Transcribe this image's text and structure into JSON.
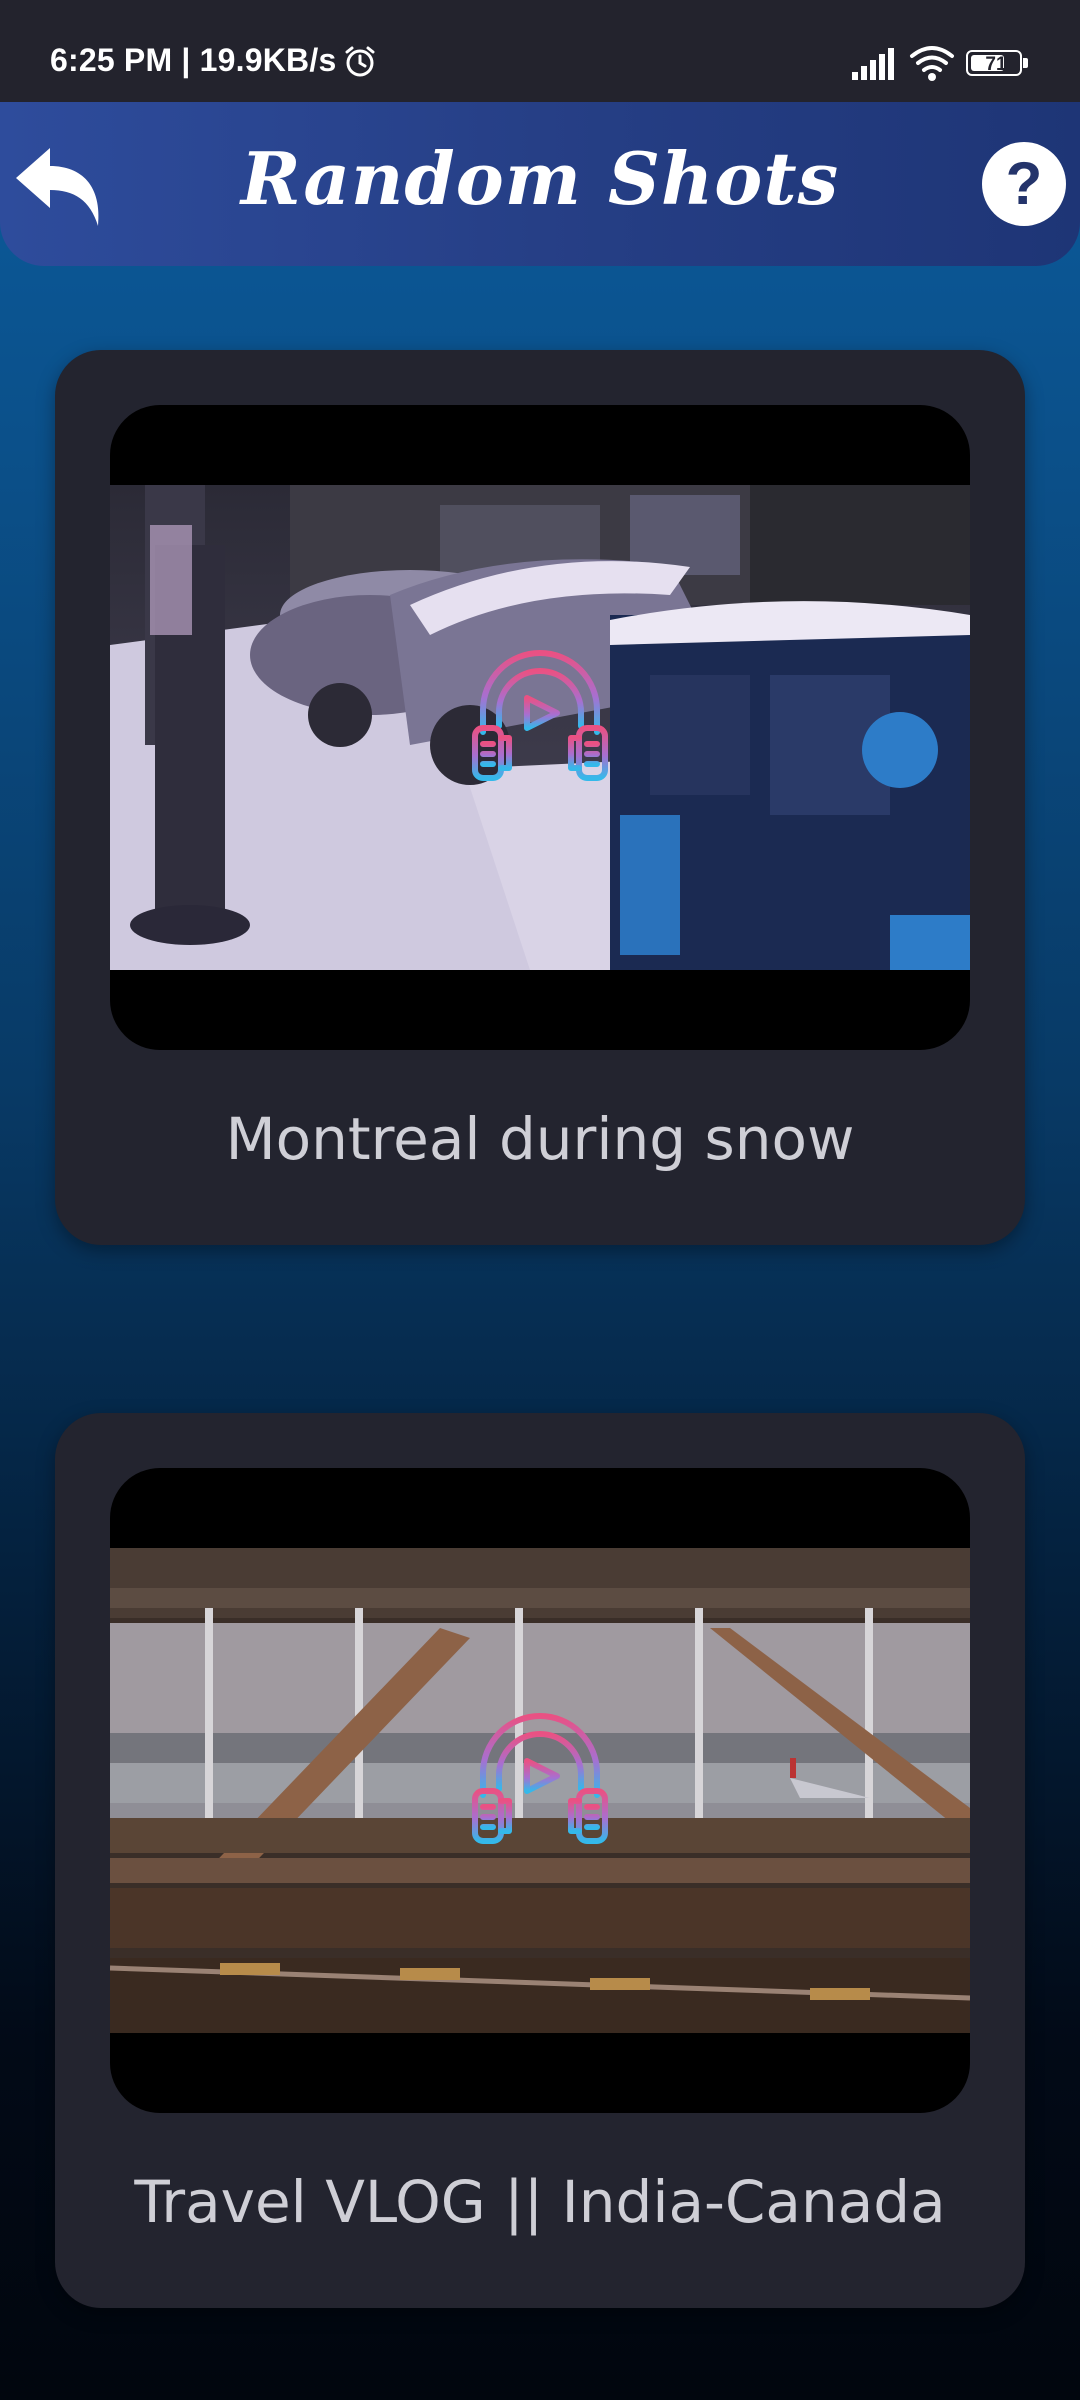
{
  "status_bar": {
    "time_speed": "6:25 PM | 19.9KB/s",
    "battery_level": "71",
    "battery_fraction": 0.71,
    "icons": [
      "alarm-icon",
      "signal-icon",
      "wifi-icon",
      "battery-icon"
    ]
  },
  "header": {
    "title": "Random Shots",
    "back_icon": "back-arrow-icon",
    "help_label": "?"
  },
  "videos": [
    {
      "title": "Montreal during snow",
      "thumbnail": "snowy street with parked cars and parking meter",
      "overlay_icon": "headphones-play-icon"
    },
    {
      "title": "Travel VLOG || India-Canada",
      "thumbnail": "airport terminal window with runway view",
      "overlay_icon": "headphones-play-icon"
    }
  ],
  "colors": {
    "status_bar": "#23232d",
    "header": "#263f86",
    "card": "#23242f",
    "accent_pink": "#e9578c",
    "accent_cyan": "#37b6e8"
  }
}
